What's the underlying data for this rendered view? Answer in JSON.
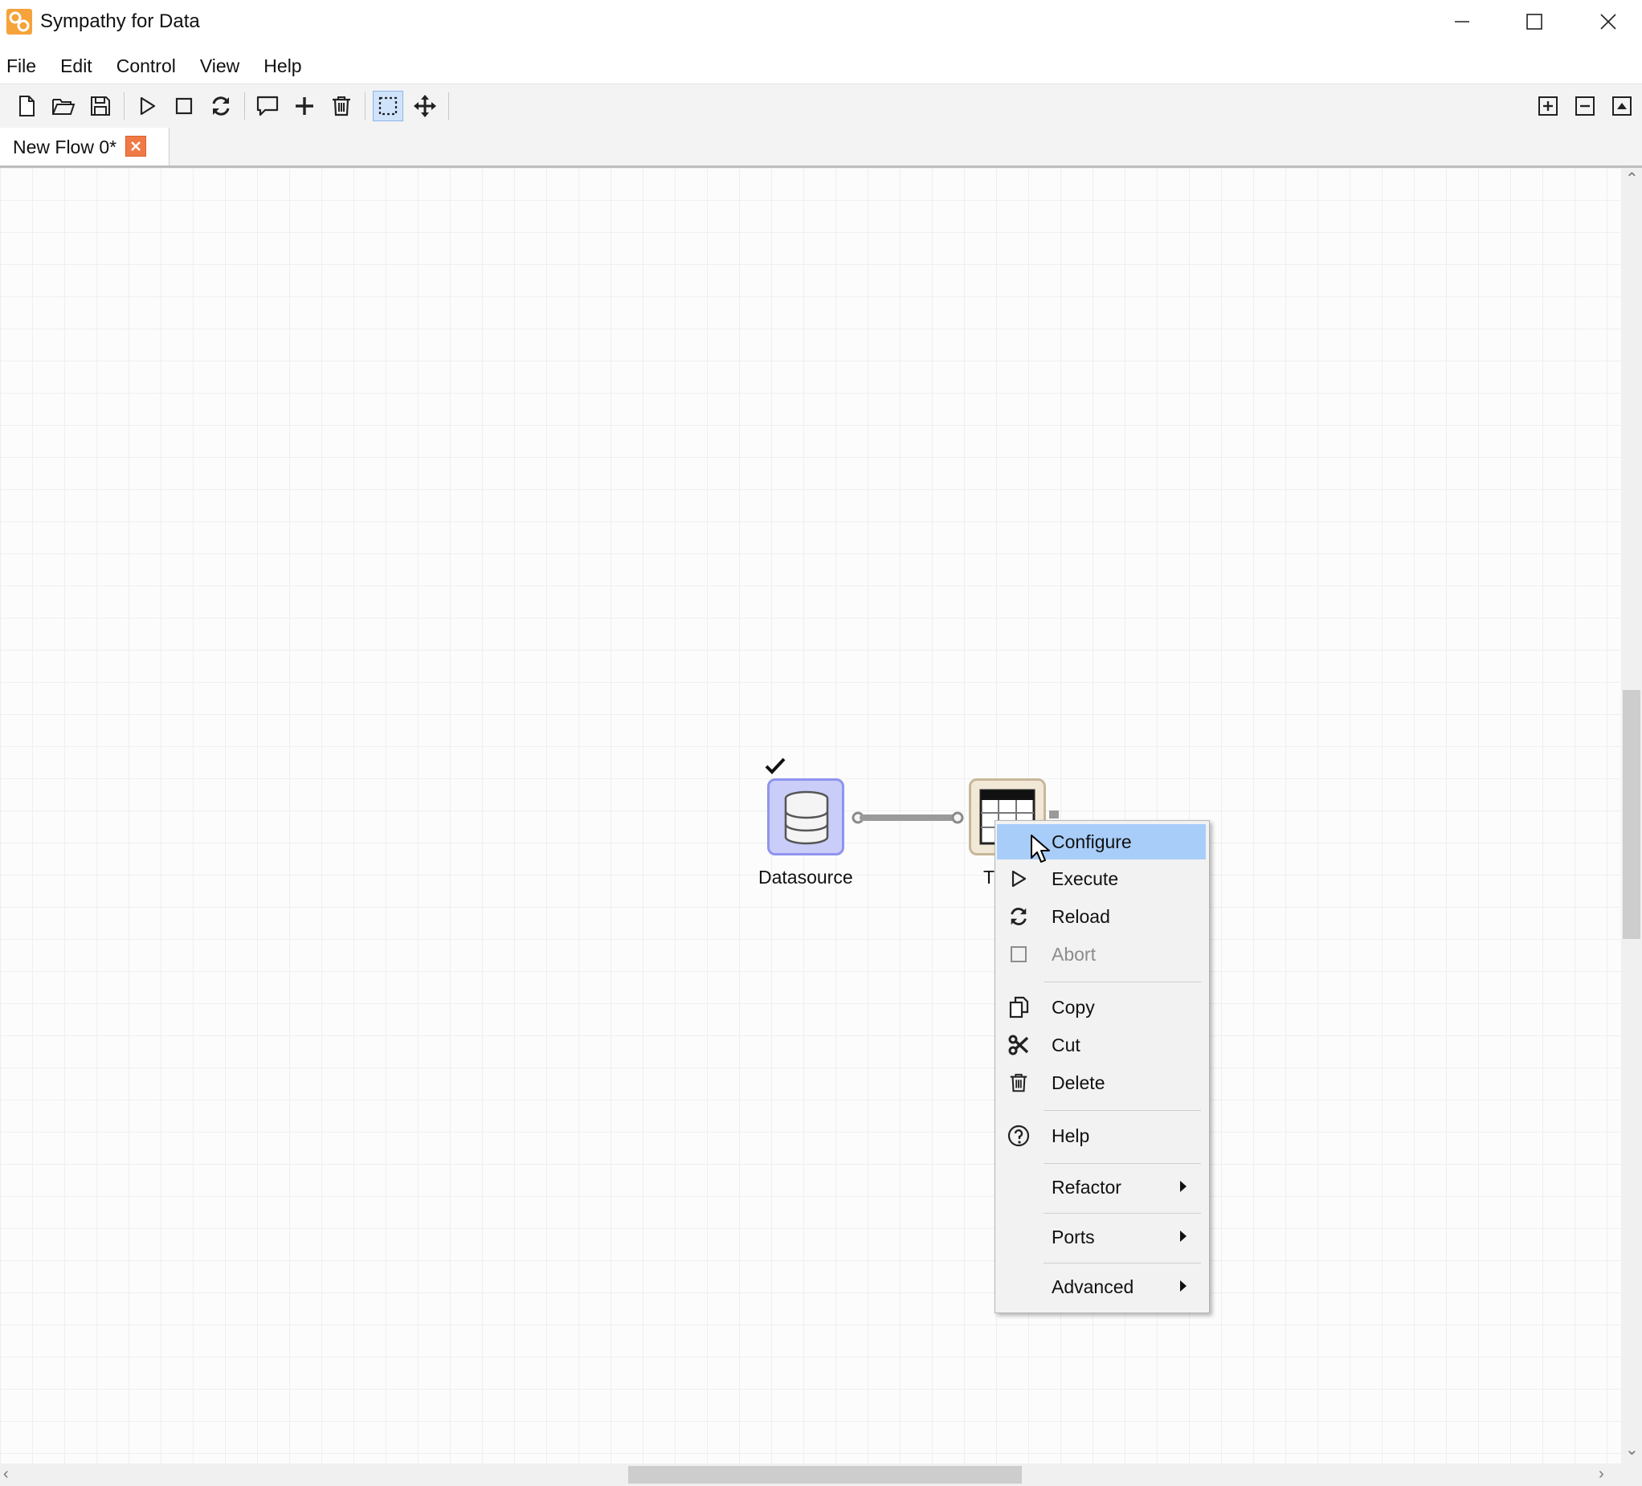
{
  "window": {
    "title": "Sympathy for Data",
    "controls": [
      "minimize-icon",
      "maximize-icon",
      "close-icon"
    ]
  },
  "menu": {
    "items": [
      "File",
      "Edit",
      "Control",
      "View",
      "Help"
    ]
  },
  "toolbar": {
    "left_icons": [
      "new-file-icon",
      "open-folder-icon",
      "save-icon",
      "play-icon",
      "stop-icon",
      "reload-icon",
      "comment-icon",
      "add-icon",
      "delete-icon",
      "select-icon",
      "move-icon"
    ],
    "active": "select-icon",
    "right_icons": [
      "expand-icon",
      "collapse-icon",
      "collapse-up-icon"
    ]
  },
  "tabs": [
    {
      "label": "New Flow 0*",
      "closable": true
    }
  ],
  "flow": {
    "nodes": [
      {
        "label": "Datasource",
        "status": "executed",
        "icon": "database-icon"
      },
      {
        "label": "T",
        "icon": "table-icon"
      }
    ]
  },
  "context_menu": {
    "items": [
      {
        "label": "Configure",
        "icon": "",
        "highlighted": true
      },
      {
        "label": "Execute",
        "icon": "play-icon"
      },
      {
        "label": "Reload",
        "icon": "reload-icon"
      },
      {
        "label": "Abort",
        "icon": "stop-icon",
        "disabled": true
      },
      {
        "label": "Copy",
        "icon": "copy-icon"
      },
      {
        "label": "Cut",
        "icon": "scissors-icon"
      },
      {
        "label": "Delete",
        "icon": "trash-icon"
      },
      {
        "label": "Help",
        "icon": "help-icon"
      },
      {
        "label": "Refactor",
        "submenu": true
      },
      {
        "label": "Ports",
        "submenu": true
      },
      {
        "label": "Advanced",
        "submenu": true
      }
    ]
  },
  "colors": {
    "node_selected_fill": "#c9cdf8",
    "node_selected_border": "#8f94ef",
    "node_table_border": "#c7b79a",
    "menu_highlight": "#a8cdf9",
    "tab_close": "#f07a46",
    "app_icon": "#f5a33a"
  }
}
